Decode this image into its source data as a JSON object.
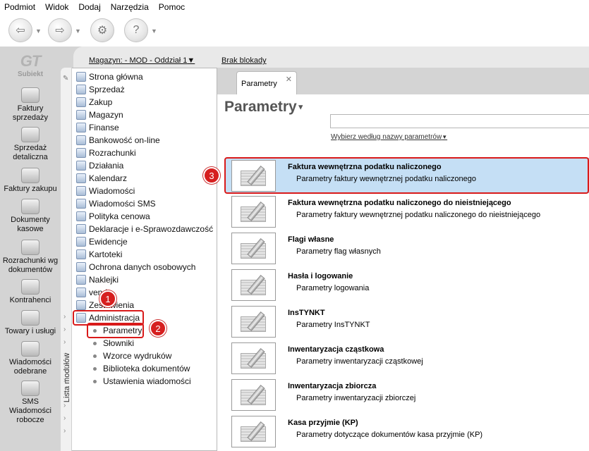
{
  "menu": [
    "Podmiot",
    "Widok",
    "Dodaj",
    "Narzędzia",
    "Pomoc"
  ],
  "logo": {
    "mark": "GT",
    "text": "Subiekt"
  },
  "left_nav": [
    {
      "label": "Faktury\nsprzedaży",
      "icon": "coins-icon"
    },
    {
      "label": "Sprzedaż\ndetaliczna",
      "icon": "register-icon"
    },
    {
      "label": "Faktury zakupu",
      "icon": "boxes-icon"
    },
    {
      "label": "Dokumenty\nkasowe",
      "icon": "cash-icon"
    },
    {
      "label": "Rozrachunki wg\ndokumentów",
      "icon": "handshake-icon"
    },
    {
      "label": "Kontrahenci",
      "icon": "person-icon"
    },
    {
      "label": "Towary i usługi",
      "icon": "products-icon"
    },
    {
      "label": "Wiadomości\nodebrane",
      "icon": "inbox-icon"
    },
    {
      "label": "SMS\nWiadomości\nrobocze",
      "icon": "sms-icon"
    }
  ],
  "header": {
    "warehouse": "Magazyn: - MOD - Oddział 1",
    "lock": "Brak blokady"
  },
  "modules_label": "Lista modułów",
  "modules": [
    "Strona główna",
    "Sprzedaż",
    "Zakup",
    "Magazyn",
    "Finanse",
    "Bankowość on-line",
    "Rozrachunki",
    "Działania",
    "Kalendarz",
    "Wiadomości",
    "Wiadomości SMS",
    "Polityka cenowa",
    "Deklaracje i e-Sprawozdawczość",
    "Ewidencje",
    "Kartoteki",
    "Ochrona danych osobowych",
    "Naklejki",
    "vendo",
    "Zestawienia",
    "Administracja"
  ],
  "submodules": [
    "Parametry",
    "Słowniki",
    "Wzorce wydruków",
    "Biblioteka dokumentów",
    "Ustawienia wiadomości"
  ],
  "badges": [
    "1",
    "2",
    "3"
  ],
  "tab": {
    "label": "Parametry",
    "close": "✕"
  },
  "page": {
    "title": "Parametry",
    "filter_link": "Wybierz według nazwy parametrów",
    "search_value": ""
  },
  "params": [
    {
      "title": "Faktura wewnętrzna podatku naliczonego",
      "desc": "Parametry faktury wewnętrznej podatku naliczonego",
      "selected": true
    },
    {
      "title": "Faktura wewnętrzna podatku naliczonego do nieistniejącego",
      "desc": "Parametry faktury wewnętrznej podatku naliczonego do nieistniejącego"
    },
    {
      "title": "Flagi własne",
      "desc": "Parametry flag własnych"
    },
    {
      "title": "Hasła i logowanie",
      "desc": "Parametry logowania"
    },
    {
      "title": "InsTYNKT",
      "desc": "Parametry InsTYNKT"
    },
    {
      "title": "Inwentaryzacja cząstkowa",
      "desc": "Parametry inwentaryzacji cząstkowej"
    },
    {
      "title": "Inwentaryzacja zbiorcza",
      "desc": "Parametry inwentaryzacji zbiorczej"
    },
    {
      "title": "Kasa przyjmie (KP)",
      "desc": "Parametry dotyczące dokumentów kasa przyjmie (KP)"
    }
  ],
  "colors": {
    "highlight": "#d91a1a",
    "selection": "#c5dff5"
  }
}
